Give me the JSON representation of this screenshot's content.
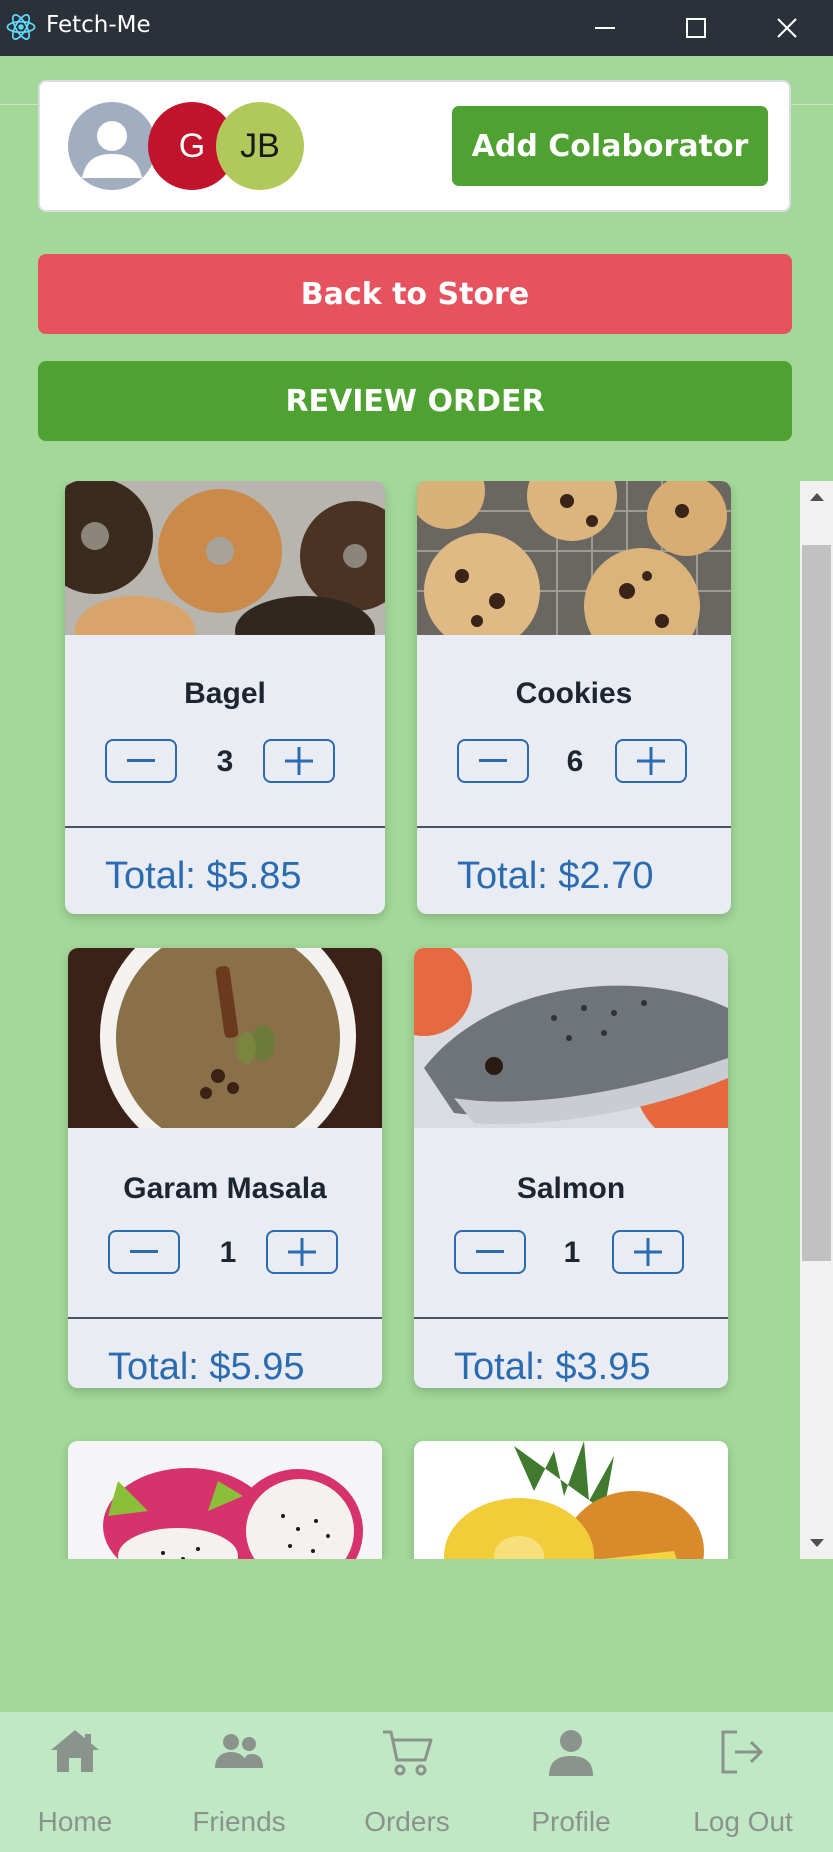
{
  "window": {
    "title": "Fetch-Me"
  },
  "collaborators": {
    "avatars": [
      {
        "initials": ""
      },
      {
        "initials": "G",
        "color": "#c1132c"
      },
      {
        "initials": "JB",
        "color": "#b1c95a"
      }
    ],
    "add_label": "Add Colaborator"
  },
  "actions": {
    "back_label": "Back to Store",
    "review_label": "REVIEW ORDER"
  },
  "products": [
    {
      "name": "Bagel",
      "quantity": "3",
      "total": "Total: $5.85",
      "image": "bagel-photo"
    },
    {
      "name": "Cookies",
      "quantity": "6",
      "total": "Total: $2.70",
      "image": "cookies-photo"
    },
    {
      "name": "Garam Masala",
      "quantity": "1",
      "total": "Total: $5.95",
      "image": "garam-masala-photo"
    },
    {
      "name": "Salmon",
      "quantity": "1",
      "total": "Total: $3.95",
      "image": "salmon-photo"
    },
    {
      "name": "",
      "image": "dragon-fruit-photo"
    },
    {
      "name": "",
      "image": "pineapple-photo"
    }
  ],
  "nav": {
    "items": [
      {
        "label": "Home",
        "icon": "home-icon"
      },
      {
        "label": "Friends",
        "icon": "friends-icon"
      },
      {
        "label": "Orders",
        "icon": "cart-icon"
      },
      {
        "label": "Profile",
        "icon": "profile-icon"
      },
      {
        "label": "Log Out",
        "icon": "logout-icon"
      }
    ]
  },
  "colors": {
    "background": "#a3d899",
    "primary_green": "#4fa131",
    "back_red": "#e6535e",
    "accent_blue": "#2b6cb0",
    "nav_background": "#c0e8c4"
  }
}
